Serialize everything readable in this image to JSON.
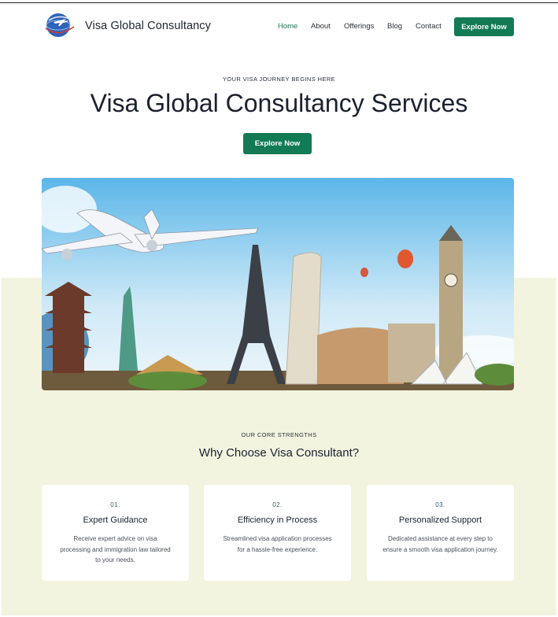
{
  "header": {
    "brand": "Visa Global Consultancy",
    "nav": [
      "Home",
      "About",
      "Offerings",
      "Blog",
      "Contact"
    ],
    "cta_label": "Explore Now"
  },
  "hero": {
    "eyebrow": "YOUR VISA JOURNEY BEGINS HERE",
    "title": "Visa Global Consultancy Services",
    "cta_label": "Explore Now"
  },
  "strengths": {
    "eyebrow": "OUR CORE STRENGTHS",
    "title": "Why Choose Visa Consultant?",
    "cards": [
      {
        "num": "01.",
        "title": "Expert Guidance",
        "desc": "Receive expert advice on visa processing and immigration law tailored to your needs."
      },
      {
        "num": "02.",
        "title": "Efficiency in Process",
        "desc": "Streamlined visa application processes for a hassle-free experience."
      },
      {
        "num": "03.",
        "title": "Personalized Support",
        "desc": "Dedicated assistance at every step to ensure a smooth visa application journey."
      }
    ]
  },
  "colors": {
    "accent": "#127b54",
    "band": "#f2f4df"
  }
}
